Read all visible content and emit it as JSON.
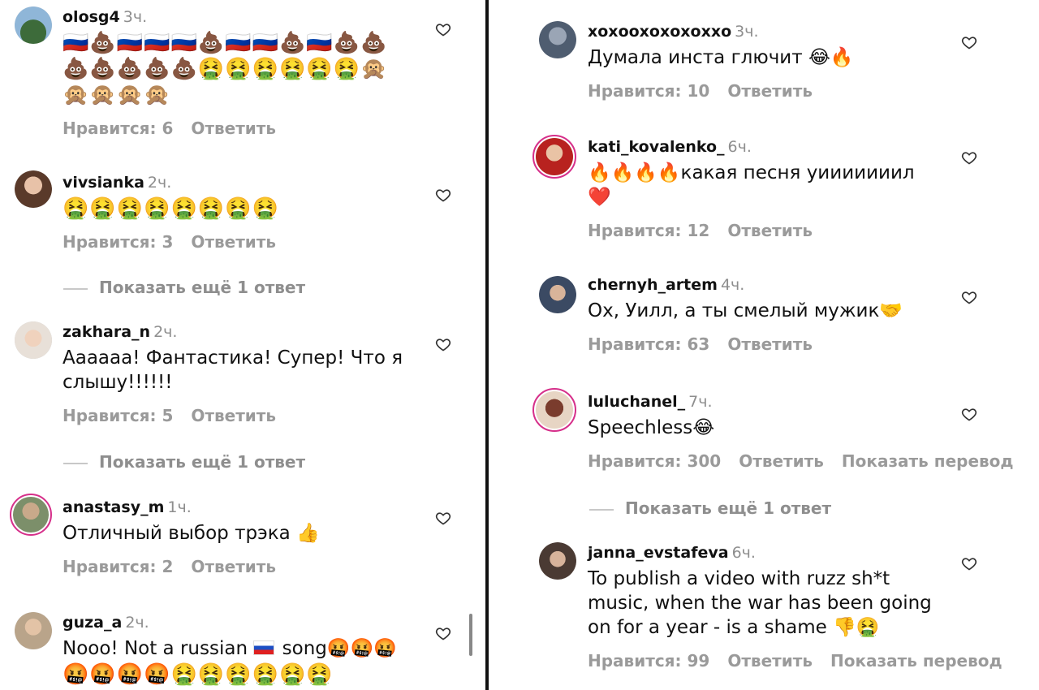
{
  "left": {
    "comments": [
      {
        "username": "olosg4",
        "time": "3ч.",
        "emoji_lines": [
          "🇷🇺💩🇷🇺🇷🇺🇷🇺💩🇷🇺🇷🇺💩🇷🇺💩💩",
          "💩💩💩💩💩🤮🤮🤮🤮🤮🤮🙊",
          "🙊🙊🙊🙊"
        ],
        "likes": "Нравится: 6",
        "reply": "Ответить"
      },
      {
        "username": "vivsianka",
        "time": "2ч.",
        "emoji_lines": [
          "🤮🤮🤮🤮🤮🤮🤮🤮"
        ],
        "likes": "Нравится: 3",
        "reply": "Ответить"
      },
      {
        "username": "zakhara_n",
        "time": "2ч.",
        "text": "Аааааа! Фантастика! Супер! Что я слышу!!!!!!",
        "likes": "Нравится: 5",
        "reply": "Ответить"
      },
      {
        "username": "anastasy_m",
        "time": "1ч.",
        "text": "Отличный выбор трэка 👍",
        "likes": "Нравится: 2",
        "reply": "Ответить"
      },
      {
        "username": "guza_a",
        "time": "2ч.",
        "text_a": "Nooo! Not a russian",
        "text_b": "song🤬🤬🤬",
        "emoji_lines": [
          "🤬🤬🤬🤬🤮🤮🤮🤮🤮🤮"
        ]
      }
    ],
    "more_replies_1": "Показать ещё 1 ответ",
    "more_replies_2": "Показать ещё 1 ответ"
  },
  "right": {
    "comments": [
      {
        "username": "xoxooxoxoxoxxo",
        "time": "3ч.",
        "text": "Думала инста глючит 😂🔥",
        "likes": "Нравится: 10",
        "reply": "Ответить"
      },
      {
        "username": "kati_kovalenko_",
        "time": "6ч.",
        "text": "🔥🔥🔥🔥какая песня уииииииил",
        "text2": "❤️",
        "likes": "Нравится: 12",
        "reply": "Ответить"
      },
      {
        "username": "chernyh_artem",
        "time": "4ч.",
        "text": "Ох, Уилл, а ты смелый мужик🤝",
        "likes": "Нравится: 63",
        "reply": "Ответить"
      },
      {
        "username": "luluchanel_",
        "time": "7ч.",
        "text": "Speechless😂",
        "likes": "Нравится: 300",
        "reply": "Ответить",
        "translate": "Показать перевод"
      },
      {
        "username": "janna_evstafeva",
        "time": "6ч.",
        "text": "To publish a video with ruzz sh*t music, when the war has been going on for a year - is a shame 👎🤮",
        "likes": "Нравится: 99",
        "reply": "Ответить",
        "translate": "Показать перевод"
      }
    ],
    "more_replies": "Показать ещё 1 ответ"
  },
  "colors": {
    "story_ring": "#d62f8a",
    "meta_grey": "#8e8e8e",
    "divider": "#111111"
  },
  "icons": {
    "like": "heart-outline-icon"
  }
}
